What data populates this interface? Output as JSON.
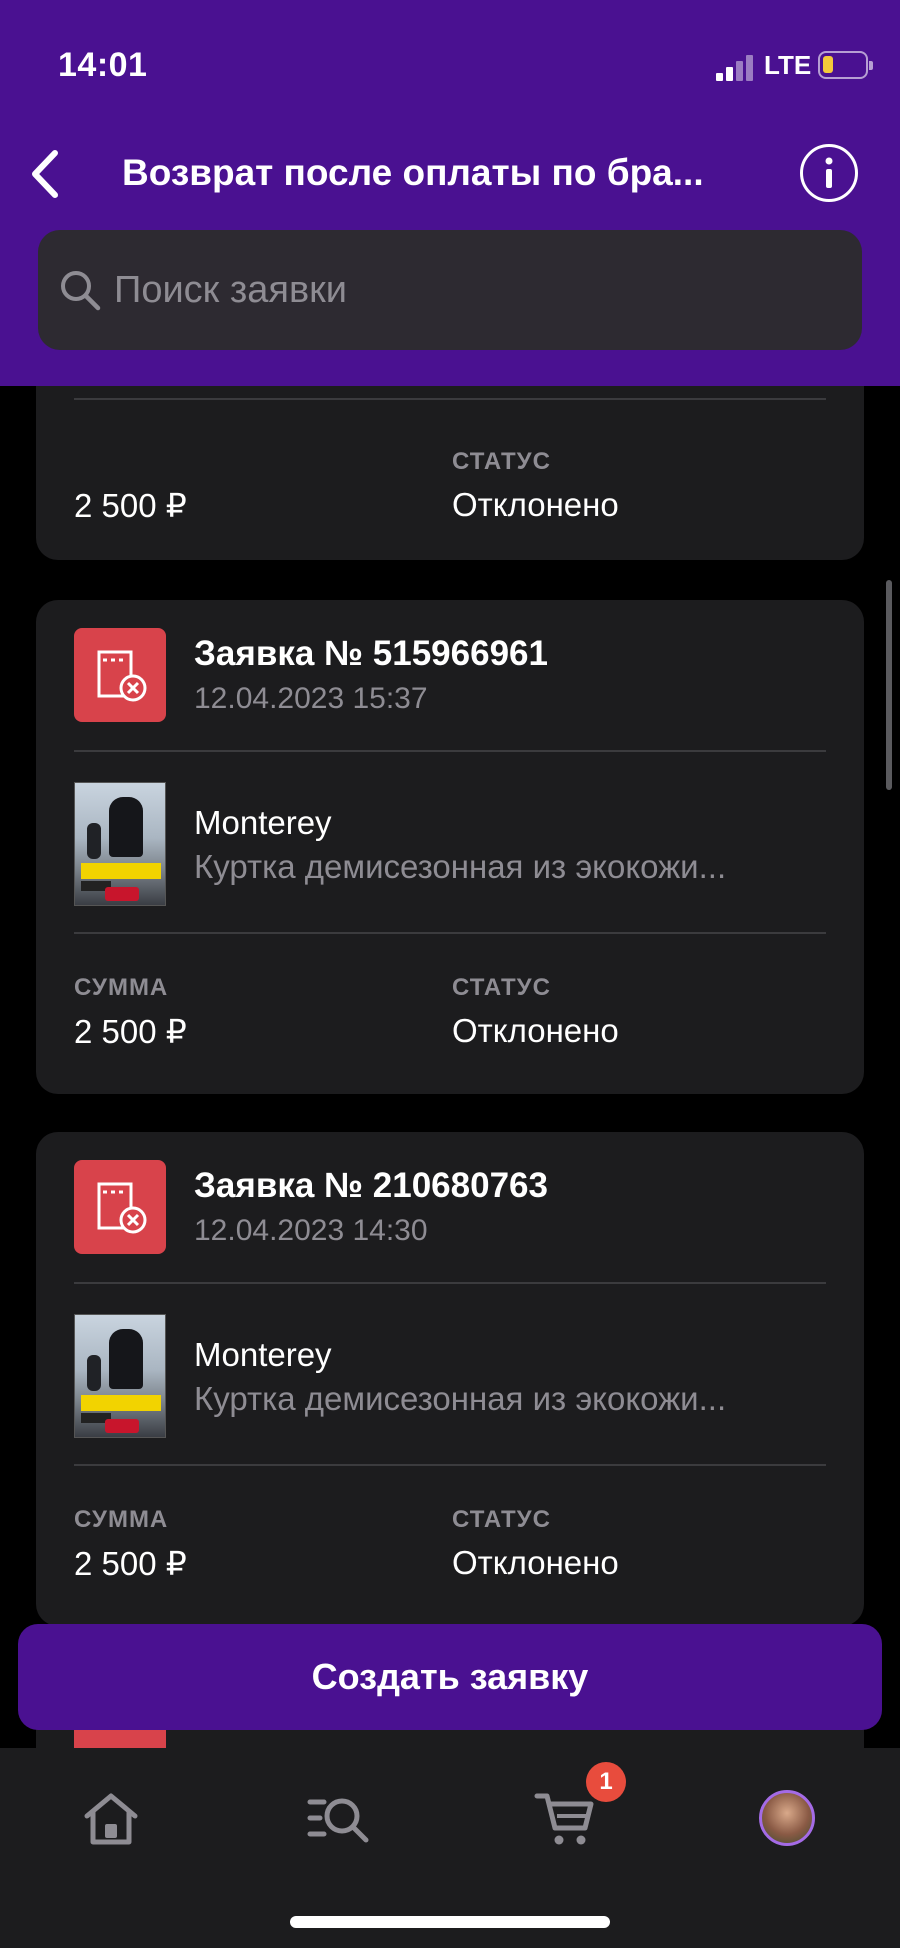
{
  "status_bar": {
    "time": "14:01",
    "network": "LTE"
  },
  "header": {
    "title": "Возврат после оплаты по бра..."
  },
  "search": {
    "placeholder": "Поиск заявки"
  },
  "labels": {
    "sum": "СУММА",
    "status": "СТАТУС"
  },
  "requests": [
    {
      "sum": "2 500 ₽",
      "status": "Отклонено"
    },
    {
      "title": "Заявка № 515966961",
      "date": "12.04.2023 15:37",
      "brand": "Monterey",
      "product": "Куртка демисезонная из экокожи...",
      "sum": "2 500 ₽",
      "status": "Отклонено"
    },
    {
      "title": "Заявка № 210680763",
      "date": "12.04.2023 14:30",
      "brand": "Monterey",
      "product": "Куртка демисезонная из экокожи...",
      "sum": "2 500 ₽",
      "status": "Отклонено"
    }
  ],
  "create_button": {
    "label": "Создать заявку"
  },
  "tabbar": {
    "cart_badge": "1"
  },
  "colors": {
    "brand": "#4a1191",
    "card": "#1c1c1e",
    "danger": "#d8434b",
    "badge": "#e84c3d"
  }
}
